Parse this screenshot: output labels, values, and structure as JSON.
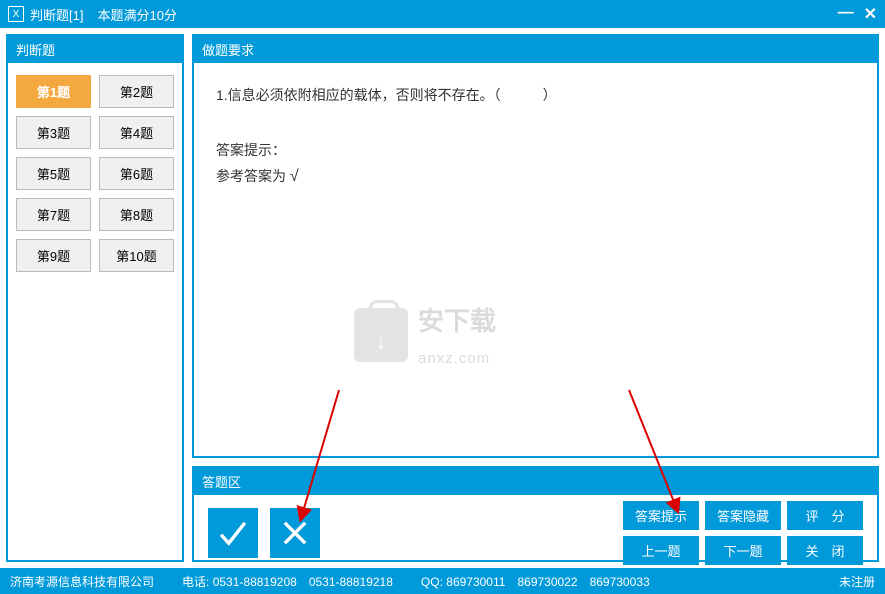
{
  "titlebar": {
    "icon_label": "X",
    "title": "判断题[1]",
    "score": "本题满分10分"
  },
  "sidebar": {
    "header": "判断题",
    "questions": [
      "第1题",
      "第2题",
      "第3题",
      "第4题",
      "第5题",
      "第6题",
      "第7题",
      "第8题",
      "第9题",
      "第10题"
    ],
    "active_index": 0
  },
  "question_panel": {
    "header": "做题要求",
    "question_text": "1.信息必须依附相应的载体，否则将不存在。（　　　）",
    "hint_label": "答案提示：",
    "ref_answer_label": "参考答案为",
    "ref_answer_mark": "√"
  },
  "watermark": {
    "cn": "安下载",
    "en": "anxz.com"
  },
  "answer_panel": {
    "header": "答题区",
    "actions": {
      "hint": "答案提示",
      "hide": "答案隐藏",
      "score": "评　分",
      "prev": "上一题",
      "next": "下一题",
      "close": "关　闭"
    }
  },
  "footer": {
    "company": "济南考源信息科技有限公司",
    "phone_label": "电话:",
    "phone1": "0531-88819208",
    "phone2": "0531-88819218",
    "qq_label": "QQ:",
    "qq1": "869730011",
    "qq2": "869730022",
    "qq3": "869730033",
    "status": "未注册"
  }
}
